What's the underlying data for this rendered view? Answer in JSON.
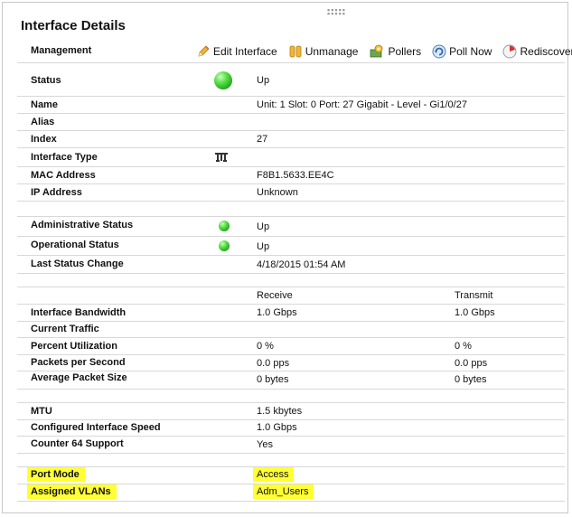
{
  "panel": {
    "title": "Interface Details"
  },
  "management": {
    "label": "Management",
    "actions": [
      {
        "label": "Edit Interface",
        "icon": "pencil-icon"
      },
      {
        "label": "Unmanage",
        "icon": "pause-icon"
      },
      {
        "label": "Pollers",
        "icon": "pollers-icon"
      },
      {
        "label": "Poll Now",
        "icon": "refresh-icon"
      },
      {
        "label": "Rediscovery",
        "icon": "rediscovery-icon"
      }
    ]
  },
  "status": {
    "label": "Status",
    "value": "Up",
    "color": "#33cc22"
  },
  "general": [
    {
      "label": "Name",
      "value": "Unit: 1 Slot: 0 Port: 27 Gigabit - Level - Gi1/0/27"
    },
    {
      "label": "Alias",
      "value": ""
    },
    {
      "label": "Index",
      "value": "27"
    },
    {
      "label": "Interface Type",
      "value": "",
      "icon": "interface-type-icon"
    },
    {
      "label": "MAC Address",
      "value": "F8B1.5633.EE4C"
    },
    {
      "label": "IP Address",
      "value": "Unknown"
    }
  ],
  "state": [
    {
      "label": "Administrative Status",
      "value": "Up"
    },
    {
      "label": "Operational Status",
      "value": "Up"
    },
    {
      "label": "Last Status Change",
      "value": "4/18/2015 01:54 AM"
    }
  ],
  "traffic": {
    "headers": {
      "receive": "Receive",
      "transmit": "Transmit"
    },
    "rows": [
      {
        "label": "Interface Bandwidth",
        "receive": "1.0 Gbps",
        "transmit": "1.0 Gbps"
      },
      {
        "label": "Current Traffic",
        "receive": "",
        "transmit": ""
      },
      {
        "label": "Percent Utilization",
        "receive": "0 %",
        "transmit": "0 %"
      },
      {
        "label": "Packets per Second",
        "receive": "0.0 pps",
        "transmit": "0.0 pps"
      },
      {
        "label": "Average Packet Size",
        "receive": "0 bytes",
        "transmit": "0 bytes"
      }
    ]
  },
  "config": [
    {
      "label": "MTU",
      "value": "1.5 kbytes"
    },
    {
      "label": "Configured Interface Speed",
      "value": "1.0 Gbps"
    },
    {
      "label": "Counter 64 Support",
      "value": "Yes"
    }
  ],
  "port": [
    {
      "label": "Port Mode",
      "value": "Access"
    },
    {
      "label": "Assigned VLANs",
      "value": "Adm_Users"
    }
  ],
  "highlight_color": "#ffff33"
}
